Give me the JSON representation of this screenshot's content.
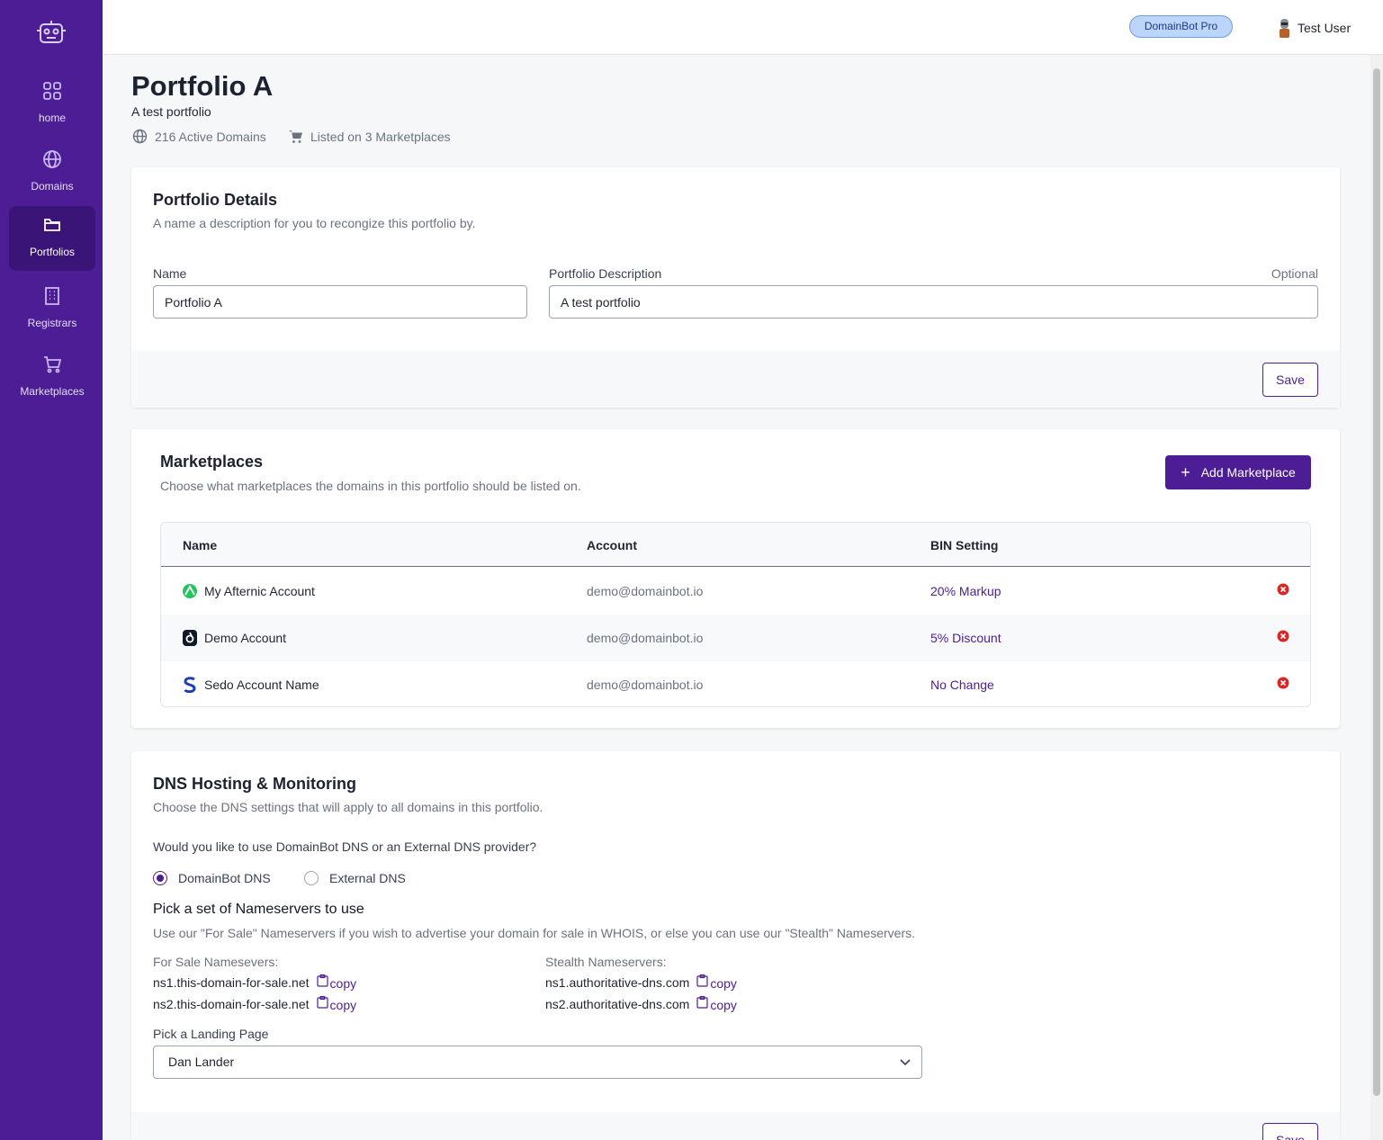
{
  "sidebar": {
    "items": [
      {
        "label": "home",
        "icon": "grid-icon",
        "active": false
      },
      {
        "label": "Domains",
        "icon": "globe-icon",
        "active": false
      },
      {
        "label": "Portfolios",
        "icon": "folder-icon",
        "active": true
      },
      {
        "label": "Registrars",
        "icon": "building-icon",
        "active": false
      },
      {
        "label": "Marketplaces",
        "icon": "cart-icon",
        "active": false
      }
    ]
  },
  "header": {
    "plan_badge": "DomainBot Pro",
    "user_name": "Test User"
  },
  "page": {
    "title": "Portfolio A",
    "subtitle": "A test portfolio",
    "stats": {
      "active_domains": "216 Active Domains",
      "marketplaces": "Listed on 3 Marketplaces"
    }
  },
  "details": {
    "title": "Portfolio Details",
    "description": "A name a description for you to recongize this portfolio by.",
    "name_label": "Name",
    "name_value": "Portfolio A",
    "desc_label": "Portfolio Description",
    "desc_optional": "Optional",
    "desc_value": "A test portfolio",
    "save_label": "Save"
  },
  "marketplaces": {
    "title": "Marketplaces",
    "description": "Choose what marketplaces the domains in this portfolio should be listed on.",
    "add_label": "Add Marketplace",
    "columns": [
      "Name",
      "Account",
      "BIN Setting"
    ],
    "rows": [
      {
        "name": "My Afternic Account",
        "account": "demo@domainbot.io",
        "bin": "20% Markup",
        "icon": "afternic-icon"
      },
      {
        "name": "Demo Account",
        "account": "demo@domainbot.io",
        "bin": "5% Discount",
        "icon": "dan-icon"
      },
      {
        "name": "Sedo Account Name",
        "account": "demo@domainbot.io",
        "bin": "No Change",
        "icon": "sedo-icon"
      }
    ]
  },
  "dns": {
    "title": "DNS Hosting & Monitoring",
    "description": "Choose the DNS settings that will apply to all domains in this portfolio.",
    "question": "Would you like to use DomainBot DNS or an External DNS provider?",
    "options": [
      {
        "label": "DomainBot DNS",
        "checked": true
      },
      {
        "label": "External DNS",
        "checked": false
      }
    ],
    "ns_heading": "Pick a set of Nameservers to use",
    "ns_description": "Use our \"For Sale\" Nameservers if you wish to advertise your domain for sale in WHOIS, or else you can use our \"Stealth\" Nameservers.",
    "for_sale_label": "For Sale Namesevers:",
    "for_sale": [
      "ns1.this-domain-for-sale.net",
      "ns2.this-domain-for-sale.net"
    ],
    "stealth_label": "Stealth Nameservers:",
    "stealth": [
      "ns1.authoritative-dns.com",
      "ns2.authoritative-dns.com"
    ],
    "copy_label": "copy",
    "landing_label": "Pick a Landing Page",
    "landing_value": "Dan Lander",
    "save_label": "Save"
  },
  "colors": {
    "brand": "#4c1d95",
    "danger": "#dc2626",
    "badge_bg": "#bcd5fb"
  }
}
